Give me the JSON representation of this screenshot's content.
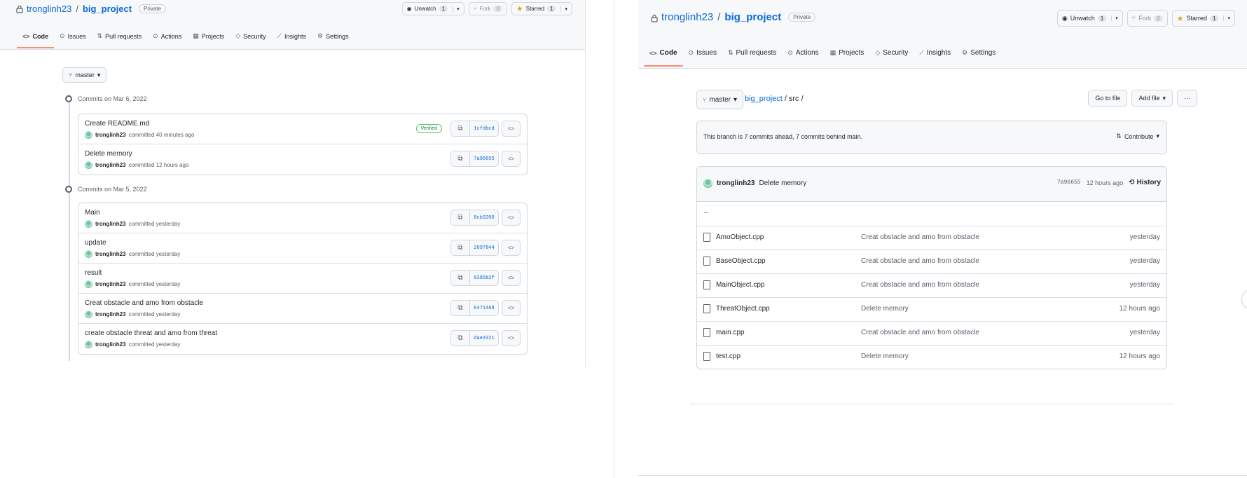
{
  "left": {
    "repo": {
      "owner": "tronglinh23",
      "separator": "/",
      "name": "big_project",
      "visibility": "Private"
    },
    "actions": {
      "unwatch_label": "Unwatch",
      "unwatch_count": "1",
      "fork_label": "Fork",
      "fork_count": "0",
      "star_label": "Starred",
      "star_count": "1"
    },
    "tabs": [
      {
        "label": "Code",
        "icon": "code-icon"
      },
      {
        "label": "Issues",
        "icon": "issue-icon"
      },
      {
        "label": "Pull requests",
        "icon": "pull-request-icon"
      },
      {
        "label": "Actions",
        "icon": "play-icon"
      },
      {
        "label": "Projects",
        "icon": "table-icon"
      },
      {
        "label": "Security",
        "icon": "shield-icon"
      },
      {
        "label": "Insights",
        "icon": "graph-icon"
      },
      {
        "label": "Settings",
        "icon": "gear-icon"
      }
    ],
    "branch": "master",
    "days": [
      {
        "heading": "Commits on Mar 6, 2022",
        "commits": [
          {
            "message": "Create README.md",
            "author": "tronglinh23",
            "time": "committed 40 minutes ago",
            "sha": "1cfdbcd",
            "verified": "Verified"
          },
          {
            "message": "Delete memory",
            "author": "tronglinh23",
            "time": "committed 12 hours ago",
            "sha": "7a96655"
          }
        ]
      },
      {
        "heading": "Commits on Mar 5, 2022",
        "commits": [
          {
            "message": "Main",
            "author": "tronglinh23",
            "time": "committed yesterday",
            "sha": "8cb3200"
          },
          {
            "message": "update",
            "author": "tronglinh23",
            "time": "committed yesterday",
            "sha": "2097844"
          },
          {
            "message": "result",
            "author": "tronglinh23",
            "time": "committed yesterday",
            "sha": "8385b2f"
          },
          {
            "message": "Creat obstacle and amo from obstacle",
            "author": "tronglinh23",
            "time": "committed yesterday",
            "sha": "6471468"
          },
          {
            "message": "create obstacle threat and amo from threat",
            "author": "tronglinh23",
            "time": "committed yesterday",
            "sha": "dae3321"
          }
        ]
      }
    ]
  },
  "right": {
    "repo": {
      "owner": "tronglinh23",
      "separator": "/",
      "name": "big_project",
      "visibility": "Private"
    },
    "actions": {
      "unwatch_label": "Unwatch",
      "unwatch_count": "1",
      "fork_label": "Fork",
      "fork_count": "0",
      "star_label": "Starred",
      "star_count": "1"
    },
    "tabs": [
      {
        "label": "Code",
        "icon": "code-icon"
      },
      {
        "label": "Issues",
        "icon": "issue-icon"
      },
      {
        "label": "Pull requests",
        "icon": "pull-request-icon"
      },
      {
        "label": "Actions",
        "icon": "play-icon"
      },
      {
        "label": "Projects",
        "icon": "table-icon"
      },
      {
        "label": "Security",
        "icon": "shield-icon"
      },
      {
        "label": "Insights",
        "icon": "graph-icon"
      },
      {
        "label": "Settings",
        "icon": "gear-icon"
      }
    ],
    "branch": "master",
    "breadcrumb": {
      "repo": "big_project",
      "sep1": "/",
      "folder": "src",
      "sep2": "/"
    },
    "goto_file": "Go to file",
    "add_file": "Add file",
    "more": "···",
    "branch_status": "This branch is 7 commits ahead, 7 commits behind main.",
    "contribute": "Contribute",
    "latest_commit": {
      "author": "tronglinh23",
      "message": "Delete memory",
      "sha": "7a96655",
      "time": "12 hours ago",
      "history": "History"
    },
    "updir": "..",
    "files": [
      {
        "name": "AmoObject.cpp",
        "message": "Creat obstacle and amo from obstacle",
        "age": "yesterday"
      },
      {
        "name": "BaseObject.cpp",
        "message": "Creat obstacle and amo from obstacle",
        "age": "yesterday"
      },
      {
        "name": "MainObject.cpp",
        "message": "Creat obstacle and amo from obstacle",
        "age": "yesterday"
      },
      {
        "name": "ThreatObject.cpp",
        "message": "Delete memory",
        "age": "12 hours ago"
      },
      {
        "name": "main.cpp",
        "message": "Creat obstacle and amo from obstacle",
        "age": "yesterday"
      },
      {
        "name": "test.cpp",
        "message": "Delete memory",
        "age": "12 hours ago"
      }
    ]
  },
  "colors": {
    "link": "#0969da",
    "active_tab_underline": "#fd8c73",
    "verified": "#1a7f37",
    "star": "#d4a72c"
  }
}
